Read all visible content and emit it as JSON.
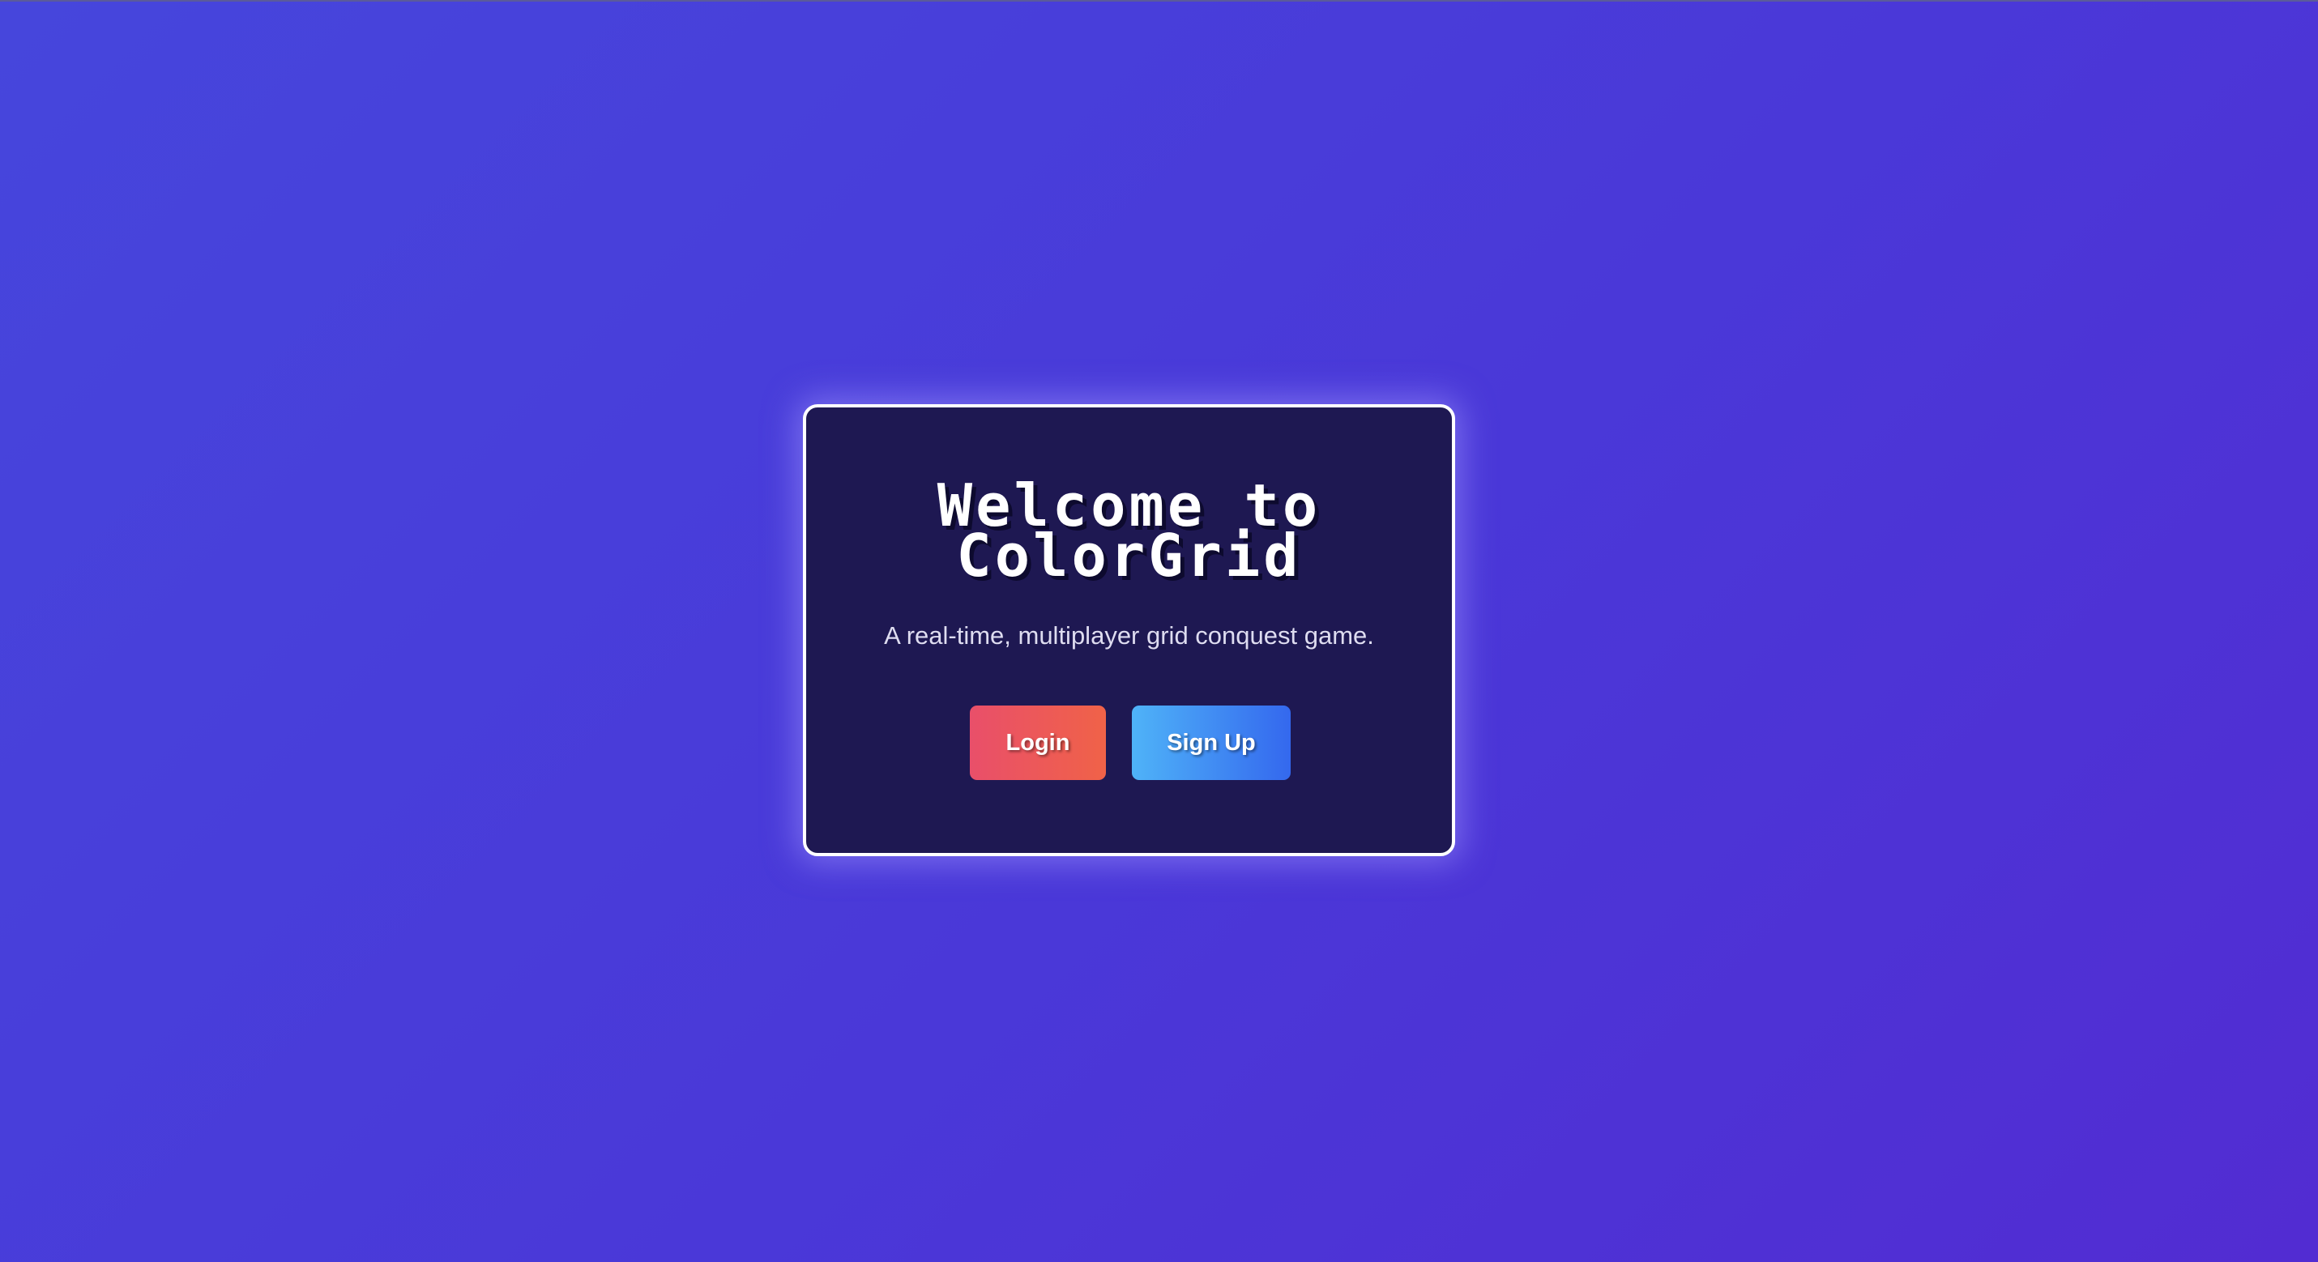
{
  "welcome": {
    "title_line1": "Welcome to",
    "title_line2": "ColorGrid",
    "subtitle": "A real-time, multiplayer grid conquest game.",
    "login_label": "Login",
    "signup_label": "Sign Up"
  },
  "colors": {
    "background_start": "#4646dc",
    "background_end": "#522cd2",
    "card_background": "#1e1852",
    "card_border": "#ffffff",
    "login_gradient": [
      "#e94f6a",
      "#f06248"
    ],
    "signup_gradient": [
      "#4fb3f8",
      "#3468ee"
    ]
  }
}
